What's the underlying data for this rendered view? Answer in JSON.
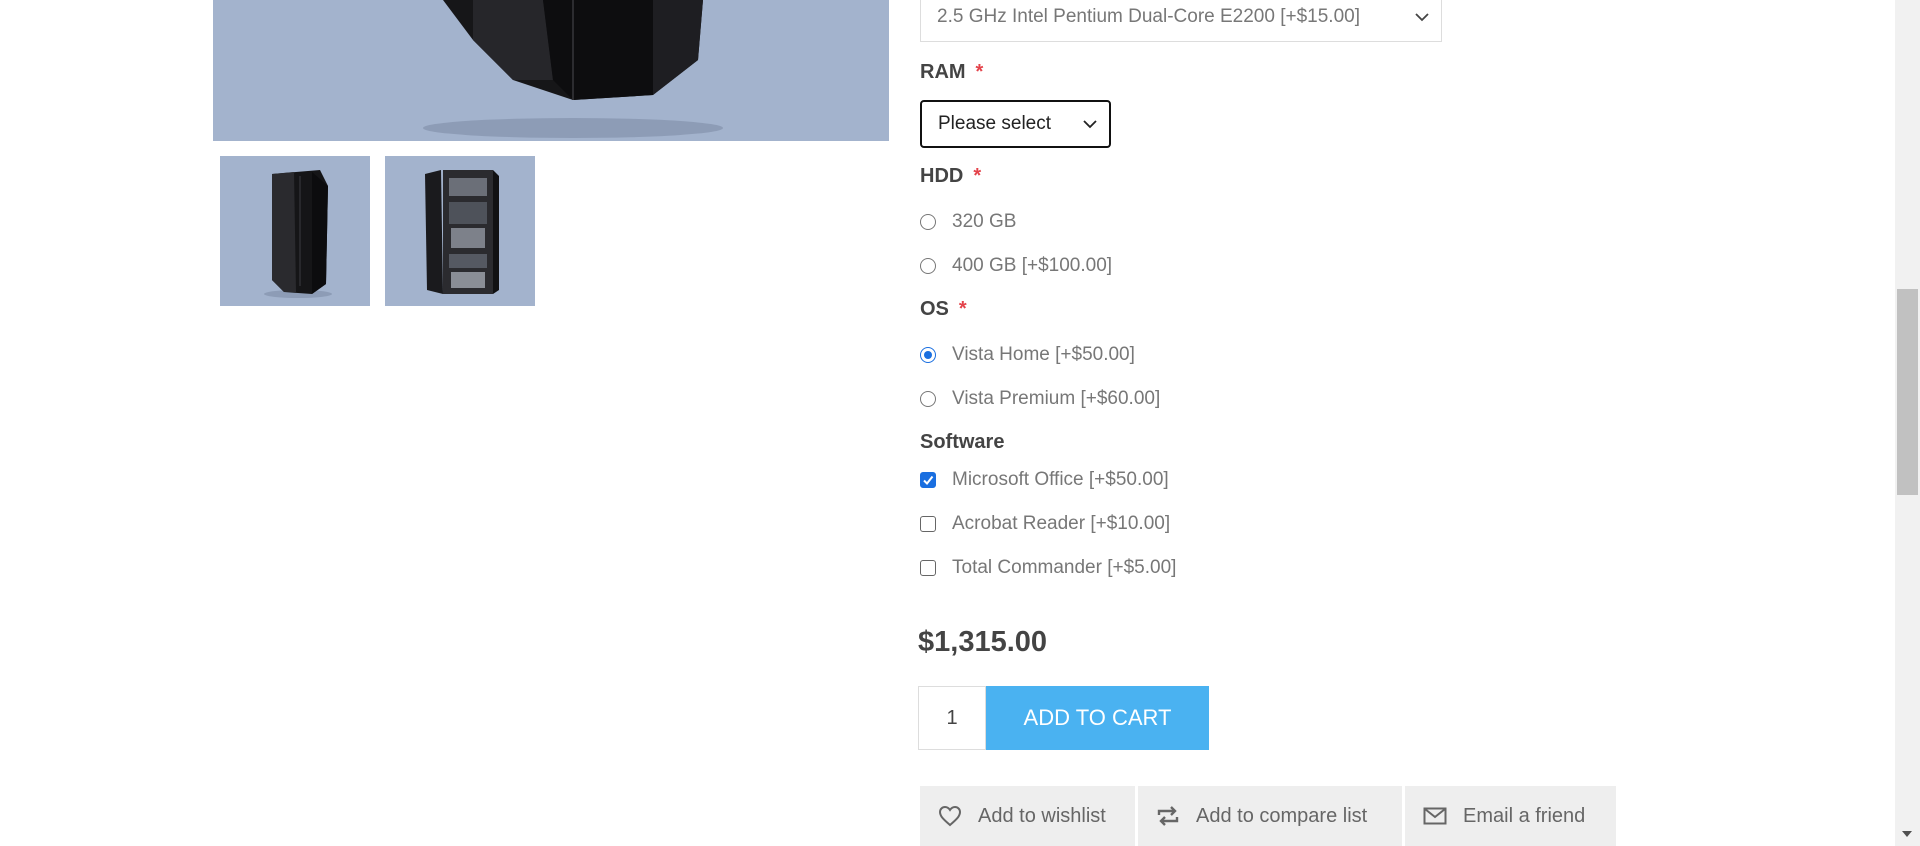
{
  "attributes": {
    "processor": {
      "selected": "2.5 GHz Intel Pentium Dual-Core E2200 [+$15.00]"
    },
    "ram": {
      "label": "RAM",
      "required_mark": "*",
      "selected": "Please select"
    },
    "hdd": {
      "label": "HDD",
      "required_mark": "*",
      "options": [
        {
          "label": "320 GB",
          "checked": false
        },
        {
          "label": "400 GB [+$100.00]",
          "checked": false
        }
      ]
    },
    "os": {
      "label": "OS",
      "required_mark": "*",
      "options": [
        {
          "label": "Vista Home [+$50.00]",
          "checked": true
        },
        {
          "label": "Vista Premium [+$60.00]",
          "checked": false
        }
      ]
    },
    "software": {
      "label": "Software",
      "options": [
        {
          "label": "Microsoft Office [+$50.00]",
          "checked": true
        },
        {
          "label": "Acrobat Reader [+$10.00]",
          "checked": false
        },
        {
          "label": "Total Commander [+$5.00]",
          "checked": false
        }
      ]
    }
  },
  "price": "$1,315.00",
  "quantity": "1",
  "add_to_cart_label": "ADD TO CART",
  "actions": {
    "wishlist": "Add to wishlist",
    "compare": "Add to compare list",
    "email": "Email a friend"
  },
  "colors": {
    "accent": "#4ab2f1",
    "required": "#e4434b",
    "image_bg": "#a3b3cd",
    "checked": "#1a6fe0"
  }
}
